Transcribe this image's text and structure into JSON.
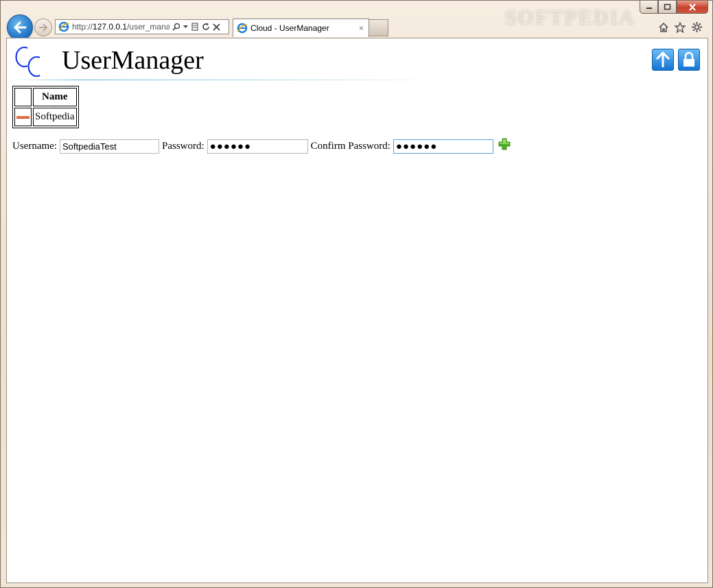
{
  "browser": {
    "watermark": "SOFTPEDIA",
    "address": {
      "prefix": "http://",
      "host": "127.0.0.1",
      "path": "/user_mana"
    },
    "tab": {
      "label": "Cloud - UserManager",
      "close": "×"
    }
  },
  "page": {
    "title": "UserManager",
    "table": {
      "header": "Name",
      "rows": [
        {
          "name": "Softpedia"
        }
      ]
    },
    "form": {
      "username_label": "Username:",
      "username_value": "SoftpediaTest",
      "password_label": "Password:",
      "password_value": "●●●●●●",
      "confirm_label": "Confirm Password:",
      "confirm_value": "●●●●●●"
    }
  },
  "colors": {
    "accent": "#1474d4",
    "delete": "#cf4b22",
    "add": "#4caf24"
  }
}
